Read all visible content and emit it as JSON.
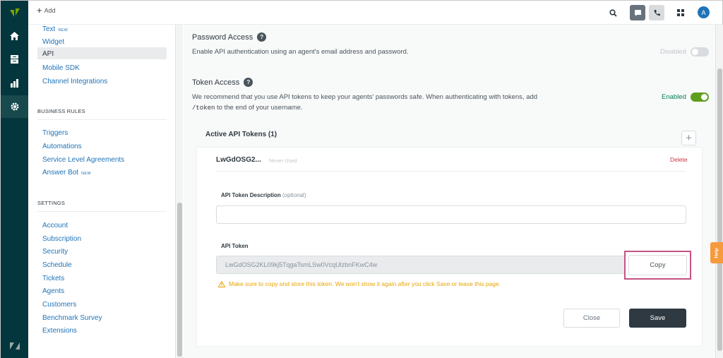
{
  "topbar": {
    "add_label": "Add",
    "avatar_initial": "A"
  },
  "sidebar": {
    "channels": [
      {
        "label": "Text",
        "badge": "NEW"
      },
      {
        "label": "Widget"
      },
      {
        "label": "API"
      },
      {
        "label": "Mobile SDK"
      },
      {
        "label": "Channel Integrations"
      }
    ],
    "business_rules_heading": "BUSINESS RULES",
    "business_rules": [
      {
        "label": "Triggers"
      },
      {
        "label": "Automations"
      },
      {
        "label": "Service Level Agreements"
      },
      {
        "label": "Answer Bot",
        "badge": "NEW"
      }
    ],
    "settings_heading": "SETTINGS",
    "settings": [
      {
        "label": "Account"
      },
      {
        "label": "Subscription"
      },
      {
        "label": "Security"
      },
      {
        "label": "Schedule"
      },
      {
        "label": "Tickets"
      },
      {
        "label": "Agents"
      },
      {
        "label": "Customers"
      },
      {
        "label": "Benchmark Survey"
      },
      {
        "label": "Extensions"
      }
    ]
  },
  "password_access": {
    "title": "Password Access",
    "description": "Enable API authentication using an agent's email address and password.",
    "status_label": "Disabled",
    "enabled": false
  },
  "token_access": {
    "title": "Token Access",
    "description_1": "We recommend that you use API tokens to keep your agents' passwords safe. When authenticating with tokens, add",
    "code": "/token",
    "description_2": "to the end of your username.",
    "status_label": "Enabled",
    "enabled": true
  },
  "active_tokens": {
    "title": "Active API Tokens (1)",
    "add_icon": "plus-icon",
    "token": {
      "name": "LwGdOSG2...",
      "usage": "Never Used",
      "delete_label": "Delete",
      "description_label": "API Token Description",
      "description_optional": "(optional)",
      "description_value": "",
      "token_label": "API Token",
      "token_value": "LwGdOSG2KL09kj5TqgaTsmLSw0VcqUlzbnFKwC4w",
      "copy_label": "Copy",
      "warning": "Make sure to copy and store this token. We won't show it again after you click Save or leave this page.",
      "close_label": "Close",
      "save_label": "Save"
    }
  },
  "help_label": "Help",
  "colors": {
    "rail": "#03363d",
    "link": "#1f73b7",
    "enabled": "#5e9e1d",
    "delete": "#cc3340",
    "warning": "#e8a500",
    "highlight": "#c45384",
    "help": "#f79a3e"
  }
}
